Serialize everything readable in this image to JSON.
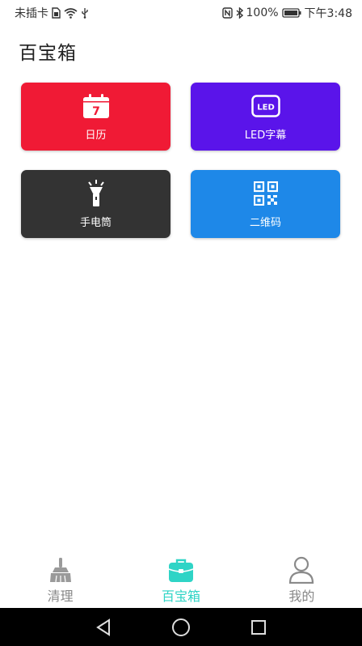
{
  "status_bar": {
    "carrier": "未插卡",
    "battery": "100%",
    "time": "下午3:48"
  },
  "page": {
    "title": "百宝箱"
  },
  "tiles": [
    {
      "label": "日历",
      "icon": "calendar-icon",
      "icon_text": "7",
      "color": "#f01a35"
    },
    {
      "label": "LED字幕",
      "icon": "led-icon",
      "icon_text": "LED",
      "color": "#5a14ea"
    },
    {
      "label": "手电筒",
      "icon": "flashlight-icon",
      "color": "#333333"
    },
    {
      "label": "二维码",
      "icon": "qr-code-icon",
      "color": "#1e88e8"
    }
  ],
  "bottom_nav": {
    "items": [
      {
        "label": "清理",
        "icon": "broom-icon",
        "active": false
      },
      {
        "label": "百宝箱",
        "icon": "toolbox-icon",
        "active": true
      },
      {
        "label": "我的",
        "icon": "user-icon",
        "active": false
      }
    ],
    "active_color": "#2fd4c6",
    "inactive_color": "#888888"
  },
  "system_nav": [
    "back-icon",
    "home-icon",
    "recents-icon"
  ]
}
